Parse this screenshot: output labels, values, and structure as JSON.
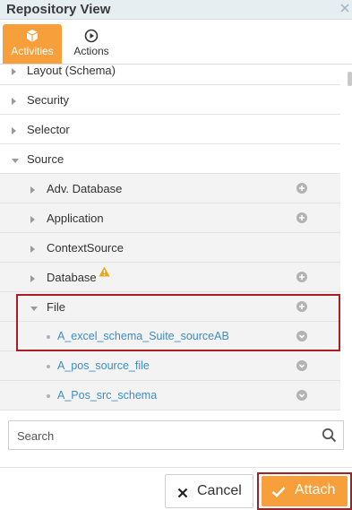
{
  "header": {
    "title": "Repository View",
    "corner_icon": "close-icon"
  },
  "tabs": [
    {
      "label": "Activities",
      "icon": "cube-icon",
      "active": true
    },
    {
      "label": "Actions",
      "icon": "play-circle-icon",
      "active": false
    }
  ],
  "tree": {
    "items": [
      {
        "label": "Layout (Schema)",
        "level": 1,
        "expanded": false
      },
      {
        "label": "Security",
        "level": 1,
        "expanded": false
      },
      {
        "label": "Selector",
        "level": 1,
        "expanded": false
      },
      {
        "label": "Source",
        "level": 1,
        "expanded": true
      },
      {
        "label": "Adv. Database",
        "level": 2,
        "expanded": false,
        "action": "plus-circle-icon"
      },
      {
        "label": "Application",
        "level": 2,
        "expanded": false,
        "action": "plus-circle-icon"
      },
      {
        "label": "ContextSource",
        "level": 2,
        "expanded": false
      },
      {
        "label": "Database",
        "level": 2,
        "expanded": false,
        "action": "plus-circle-icon",
        "warning": "warning-icon"
      },
      {
        "label": "File",
        "level": 2,
        "expanded": true,
        "action": "plus-circle-icon"
      },
      {
        "label": "A_excel_schema_Suite_sourceAB",
        "level": 3,
        "action": "chevron-down-circle-icon"
      },
      {
        "label": "A_pos_source_file",
        "level": 3,
        "action": "chevron-down-circle-icon"
      },
      {
        "label": "A_Pos_src_schema",
        "level": 3,
        "action": "chevron-down-circle-icon"
      }
    ]
  },
  "search": {
    "placeholder": "Search",
    "value": ""
  },
  "buttons": {
    "cancel_label": "Cancel",
    "attach_label": "Attach"
  },
  "colors": {
    "accent": "#f7a03b",
    "link": "#3c8dc6",
    "highlight_border": "#a61f25",
    "header_bg": "#e7eef2"
  }
}
